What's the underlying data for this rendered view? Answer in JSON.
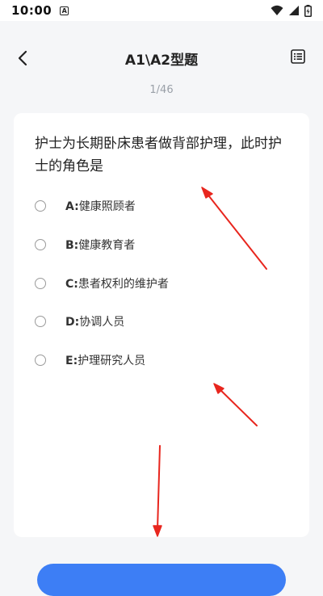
{
  "status_bar": {
    "time": "10:00",
    "notification_icon": "a-notification-icon",
    "wifi_icon": "wifi-icon",
    "signal_icon": "cell-signal-icon",
    "battery_icon": "battery-icon"
  },
  "nav": {
    "title": "A1\\A2型题",
    "back_icon": "chevron-left-icon",
    "list_icon": "list-icon"
  },
  "progress": {
    "text": "1/46",
    "current": 1,
    "total": 46
  },
  "question": {
    "text": "护士为长期卧床患者做背部护理，此时护士的角色是",
    "options": [
      {
        "letter": "A:",
        "text": "健康照顾者"
      },
      {
        "letter": "B:",
        "text": "健康教育者"
      },
      {
        "letter": "C:",
        "text": "患者权利的维护者"
      },
      {
        "letter": "D:",
        "text": "协调人员"
      },
      {
        "letter": "E:",
        "text": "护理研究人员"
      }
    ]
  },
  "colors": {
    "accent": "#3d7ef5",
    "annotation": "#e8261e",
    "background": "#f5f6f8"
  }
}
